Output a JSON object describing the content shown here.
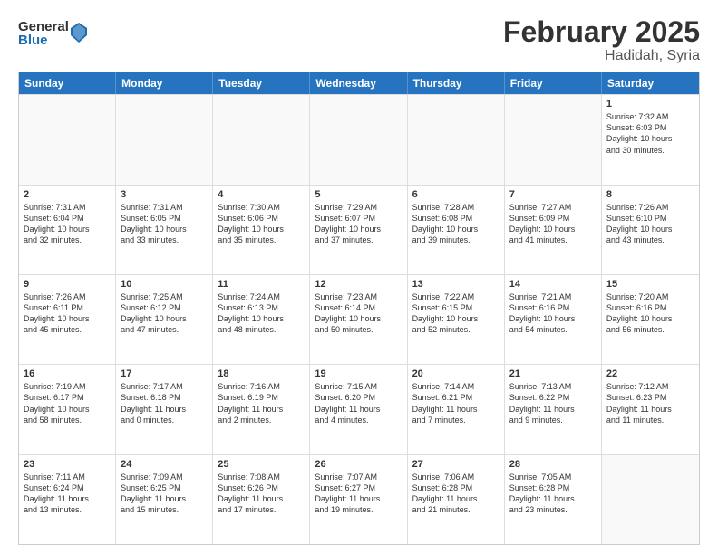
{
  "header": {
    "logo_general": "General",
    "logo_blue": "Blue",
    "month_title": "February 2025",
    "location": "Hadidah, Syria"
  },
  "days_of_week": [
    "Sunday",
    "Monday",
    "Tuesday",
    "Wednesday",
    "Thursday",
    "Friday",
    "Saturday"
  ],
  "weeks": [
    [
      {
        "day": "",
        "text": ""
      },
      {
        "day": "",
        "text": ""
      },
      {
        "day": "",
        "text": ""
      },
      {
        "day": "",
        "text": ""
      },
      {
        "day": "",
        "text": ""
      },
      {
        "day": "",
        "text": ""
      },
      {
        "day": "1",
        "text": "Sunrise: 7:32 AM\nSunset: 6:03 PM\nDaylight: 10 hours\nand 30 minutes."
      }
    ],
    [
      {
        "day": "2",
        "text": "Sunrise: 7:31 AM\nSunset: 6:04 PM\nDaylight: 10 hours\nand 32 minutes."
      },
      {
        "day": "3",
        "text": "Sunrise: 7:31 AM\nSunset: 6:05 PM\nDaylight: 10 hours\nand 33 minutes."
      },
      {
        "day": "4",
        "text": "Sunrise: 7:30 AM\nSunset: 6:06 PM\nDaylight: 10 hours\nand 35 minutes."
      },
      {
        "day": "5",
        "text": "Sunrise: 7:29 AM\nSunset: 6:07 PM\nDaylight: 10 hours\nand 37 minutes."
      },
      {
        "day": "6",
        "text": "Sunrise: 7:28 AM\nSunset: 6:08 PM\nDaylight: 10 hours\nand 39 minutes."
      },
      {
        "day": "7",
        "text": "Sunrise: 7:27 AM\nSunset: 6:09 PM\nDaylight: 10 hours\nand 41 minutes."
      },
      {
        "day": "8",
        "text": "Sunrise: 7:26 AM\nSunset: 6:10 PM\nDaylight: 10 hours\nand 43 minutes."
      }
    ],
    [
      {
        "day": "9",
        "text": "Sunrise: 7:26 AM\nSunset: 6:11 PM\nDaylight: 10 hours\nand 45 minutes."
      },
      {
        "day": "10",
        "text": "Sunrise: 7:25 AM\nSunset: 6:12 PM\nDaylight: 10 hours\nand 47 minutes."
      },
      {
        "day": "11",
        "text": "Sunrise: 7:24 AM\nSunset: 6:13 PM\nDaylight: 10 hours\nand 48 minutes."
      },
      {
        "day": "12",
        "text": "Sunrise: 7:23 AM\nSunset: 6:14 PM\nDaylight: 10 hours\nand 50 minutes."
      },
      {
        "day": "13",
        "text": "Sunrise: 7:22 AM\nSunset: 6:15 PM\nDaylight: 10 hours\nand 52 minutes."
      },
      {
        "day": "14",
        "text": "Sunrise: 7:21 AM\nSunset: 6:16 PM\nDaylight: 10 hours\nand 54 minutes."
      },
      {
        "day": "15",
        "text": "Sunrise: 7:20 AM\nSunset: 6:16 PM\nDaylight: 10 hours\nand 56 minutes."
      }
    ],
    [
      {
        "day": "16",
        "text": "Sunrise: 7:19 AM\nSunset: 6:17 PM\nDaylight: 10 hours\nand 58 minutes."
      },
      {
        "day": "17",
        "text": "Sunrise: 7:17 AM\nSunset: 6:18 PM\nDaylight: 11 hours\nand 0 minutes."
      },
      {
        "day": "18",
        "text": "Sunrise: 7:16 AM\nSunset: 6:19 PM\nDaylight: 11 hours\nand 2 minutes."
      },
      {
        "day": "19",
        "text": "Sunrise: 7:15 AM\nSunset: 6:20 PM\nDaylight: 11 hours\nand 4 minutes."
      },
      {
        "day": "20",
        "text": "Sunrise: 7:14 AM\nSunset: 6:21 PM\nDaylight: 11 hours\nand 7 minutes."
      },
      {
        "day": "21",
        "text": "Sunrise: 7:13 AM\nSunset: 6:22 PM\nDaylight: 11 hours\nand 9 minutes."
      },
      {
        "day": "22",
        "text": "Sunrise: 7:12 AM\nSunset: 6:23 PM\nDaylight: 11 hours\nand 11 minutes."
      }
    ],
    [
      {
        "day": "23",
        "text": "Sunrise: 7:11 AM\nSunset: 6:24 PM\nDaylight: 11 hours\nand 13 minutes."
      },
      {
        "day": "24",
        "text": "Sunrise: 7:09 AM\nSunset: 6:25 PM\nDaylight: 11 hours\nand 15 minutes."
      },
      {
        "day": "25",
        "text": "Sunrise: 7:08 AM\nSunset: 6:26 PM\nDaylight: 11 hours\nand 17 minutes."
      },
      {
        "day": "26",
        "text": "Sunrise: 7:07 AM\nSunset: 6:27 PM\nDaylight: 11 hours\nand 19 minutes."
      },
      {
        "day": "27",
        "text": "Sunrise: 7:06 AM\nSunset: 6:28 PM\nDaylight: 11 hours\nand 21 minutes."
      },
      {
        "day": "28",
        "text": "Sunrise: 7:05 AM\nSunset: 6:28 PM\nDaylight: 11 hours\nand 23 minutes."
      },
      {
        "day": "",
        "text": ""
      }
    ]
  ]
}
